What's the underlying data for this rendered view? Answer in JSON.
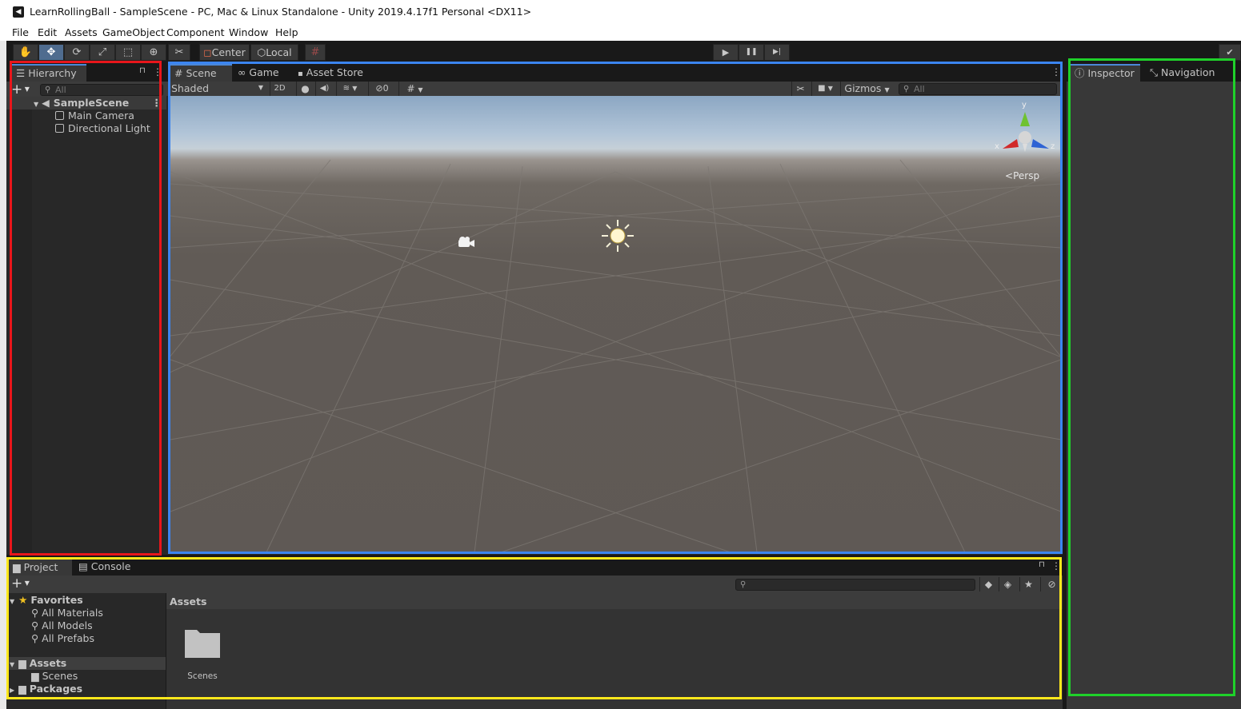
{
  "window": {
    "title": "LearnRollingBall - SampleScene - PC, Mac & Linux Standalone - Unity 2019.4.17f1 Personal <DX11>",
    "app_icon": "unity-icon"
  },
  "menu": [
    "File",
    "Edit",
    "Assets",
    "GameObject",
    "Component",
    "Window",
    "Help"
  ],
  "toolbar": {
    "tools": [
      {
        "name": "hand-tool",
        "glyph": "✋"
      },
      {
        "name": "move-tool",
        "glyph": "✥",
        "active": true
      },
      {
        "name": "rotate-tool",
        "glyph": "⟳"
      },
      {
        "name": "scale-tool",
        "glyph": "⤢"
      },
      {
        "name": "rect-tool",
        "glyph": "⬚"
      },
      {
        "name": "transform-tool",
        "glyph": "⊕"
      },
      {
        "name": "custom-editor-tool",
        "glyph": "✂"
      }
    ],
    "pivot_mode": "Center",
    "pivot_rotation": "Local",
    "snap_icon": "#",
    "play_icon": "▶",
    "pause_icon": "❚❚",
    "step_icon": "▶|"
  },
  "hierarchy": {
    "tab_label": "Hierarchy",
    "add_label": "+",
    "search_placeholder": "All",
    "lock_icon": "🔒",
    "menu_icon": "⋮",
    "scene": "SampleScene",
    "items": [
      "Main Camera",
      "Directional Light"
    ]
  },
  "scene_tabs": {
    "tabs": [
      {
        "label": "Scene",
        "icon": "#"
      },
      {
        "label": "Game",
        "icon": "∞"
      },
      {
        "label": "Asset Store",
        "icon": "🛍"
      }
    ],
    "active": "Scene"
  },
  "scene_toolbar": {
    "draw_mode": "Shaded",
    "twod": "2D",
    "hidden_count": "0",
    "gizmos": "Gizmos",
    "search_placeholder": "All"
  },
  "scene_view": {
    "projection": "Persp",
    "axis_y": "y",
    "axis_x": "x",
    "axis_z": "z"
  },
  "inspector": {
    "tabs": [
      {
        "label": "Inspector",
        "icon": "ⓘ"
      },
      {
        "label": "Navigation",
        "icon": "⤡"
      }
    ]
  },
  "project": {
    "tabs": [
      {
        "label": "Project",
        "icon": "▤"
      },
      {
        "label": "Console",
        "icon": "▤"
      }
    ],
    "add_label": "+",
    "favorites_label": "Favorites",
    "favorites": [
      "All Materials",
      "All Models",
      "All Prefabs"
    ],
    "assets_label": "Assets",
    "asset_children": [
      "Scenes"
    ],
    "packages_label": "Packages",
    "breadcrumb": "Assets",
    "files": [
      {
        "name": "Scenes",
        "type": "folder"
      }
    ]
  },
  "colors": {
    "outline_hierarchy": "#e8161b",
    "outline_scene": "#3b85f0",
    "outline_inspector": "#1fd12a",
    "outline_project": "#ffe81c",
    "accent": "#4b88d9"
  }
}
